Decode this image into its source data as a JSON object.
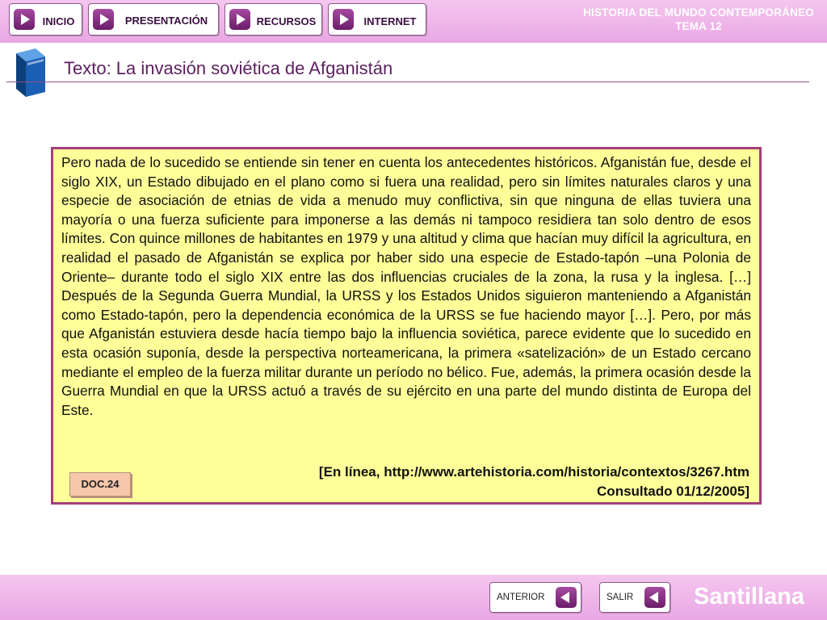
{
  "nav": {
    "inicio": "INICIO",
    "presentacion": "PRESENTACIÓN",
    "recursos": "RECURSOS",
    "internet": "INTERNET"
  },
  "header": {
    "subject_line1": "HISTORIA DEL MUNDO CONTEMPORÁNEO",
    "subject_line2": "TEMA 12",
    "title": "Texto: La invasión soviética de Afganistán"
  },
  "document": {
    "body": "Pero nada de lo sucedido se entiende sin tener en cuenta los antecedentes históricos. Afganistán fue, desde el siglo XIX, un Estado dibujado en el plano como si fuera una realidad, pero sin límites naturales claros y una especie de asociación de etnias de vida a menudo muy conflictiva, sin que ninguna de ellas tuviera una mayoría o una fuerza suficiente para imponerse a las demás ni tampoco residiera tan solo dentro de esos límites. Con quince millones de habitantes en 1979 y una altitud y clima que hacían muy difícil la agricultura, en realidad el pasado de Afganistán se explica por haber sido una especie de Estado-tapón –una Polonia de Oriente– durante todo el siglo XIX entre las dos influencias cruciales de la zona, la rusa y la inglesa. […] Después de la Segunda Guerra Mundial, la URSS y los Estados Unidos siguieron manteniendo a Afganistán como Estado-tapón, pero la dependencia económica de la URSS se fue haciendo mayor […]. Pero, por más que Afganistán estuviera desde hacía tiempo bajo la influencia soviética, parece evidente que lo sucedido en esta ocasión suponía, desde la perspectiva norteamericana, la primera «satelización» de un Estado cercano mediante el empleo de la fuerza militar durante un período no bélico. Fue, además, la primera ocasión desde la Guerra Mundial en que la URSS actuó a través de su ejército en una parte del mundo distinta de Europa del Este.",
    "citation_line1": "[En línea, http://www.artehistoria.com/historia/contextos/3267.htm",
    "citation_line2": "Consultado 01/12/2005]",
    "badge": "DOC.24"
  },
  "footer": {
    "anterior": "ANTERIOR",
    "salir": "SALIR",
    "brand": "Santillana"
  },
  "icons": {
    "nav": "play-arrow-icon",
    "footer": "back-arrow-icon",
    "header": "book-icon"
  },
  "colors": {
    "bar_pink": "#e9a7e3",
    "accent_purple": "#6b1d69",
    "doc_background": "#ffff99",
    "doc_border": "#a43f7b",
    "book_blue": "#1a5fb4"
  }
}
